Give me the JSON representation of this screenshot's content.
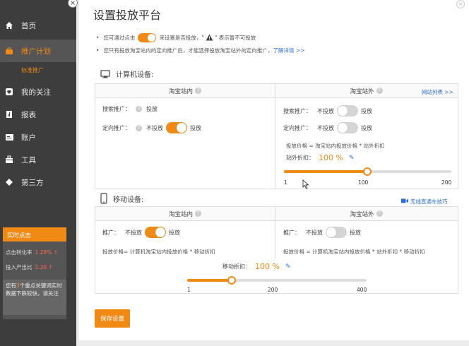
{
  "sidebar": {
    "items": [
      {
        "label": "首页",
        "icon": "home-icon"
      },
      {
        "label": "推广计划",
        "icon": "briefcase-icon",
        "active": true
      },
      {
        "label": "我的关注",
        "icon": "heart-icon"
      },
      {
        "label": "报表",
        "icon": "report-icon"
      },
      {
        "label": "账户",
        "icon": "account-icon"
      },
      {
        "label": "工具",
        "icon": "toolbox-icon"
      },
      {
        "label": "第三方",
        "icon": "diamond-icon"
      }
    ],
    "sub_item": "标准推广",
    "realtime": {
      "title": "实时点击",
      "conv_label": "点击转化率",
      "conv_value": "1.28% ↑",
      "roi_label": "投入产出比",
      "roi_value": "1.20 ↑",
      "note_pre": "您有",
      "note_count": "3",
      "note_post": "个重点关键词实时数据下跌较快，请关注"
    }
  },
  "panel": {
    "title": "设置投放平台",
    "tips": {
      "line1_a": "您可通过点击",
      "line1_b": "来设置是否投放，\"",
      "line1_c": "\" 表示暂不可投放",
      "line2_a": "您只有投放淘宝站内的定向推广后，才能选择投放淘宝站外的定向推广，",
      "line2_link": "了解详情 >>"
    },
    "pc": {
      "heading": "计算机设备:",
      "inside_head": "淘宝站内",
      "outside_head": "淘宝站外",
      "site_list_link": "网站列表 >>",
      "search_label": "搜索推广：",
      "search_value": "投放",
      "target_label": "定向推广：",
      "off_label": "不投放",
      "on_label": "投放",
      "out_search_label": "搜索推广：",
      "out_target_label": "定向推广：",
      "formula": "投放价格 = 淘宝站内投放价格 * 站外折扣",
      "discount_label": "站外折扣：",
      "discount_value": "100 %",
      "slider": {
        "min": "1",
        "mid": "100",
        "max": "200",
        "value": 100,
        "range": [
          1,
          200
        ]
      }
    },
    "mobile": {
      "heading": "移动设备:",
      "video_link": "无线直通车技巧",
      "inside_head": "淘宝站内",
      "outside_head": "淘宝站外",
      "promo_label": "推广：",
      "off_label": "不投放",
      "on_label": "投放",
      "formula_in": "投放价格= 计算机淘宝站内投放价格 * 移动折扣",
      "formula_out": "投放价格 = 计算机淘宝站内投放价格 * 站外折扣 * 移动折扣",
      "discount_label": "移动折扣：",
      "discount_value": "100 %",
      "slider": {
        "min": "1",
        "mid": "200",
        "max": "400",
        "value": 100,
        "range": [
          1,
          400
        ]
      }
    },
    "save_label": "保存设置"
  },
  "colors": {
    "accent": "#f08a14",
    "link": "#2a6fd6",
    "sidebar_bg": "#3d3d3d"
  }
}
